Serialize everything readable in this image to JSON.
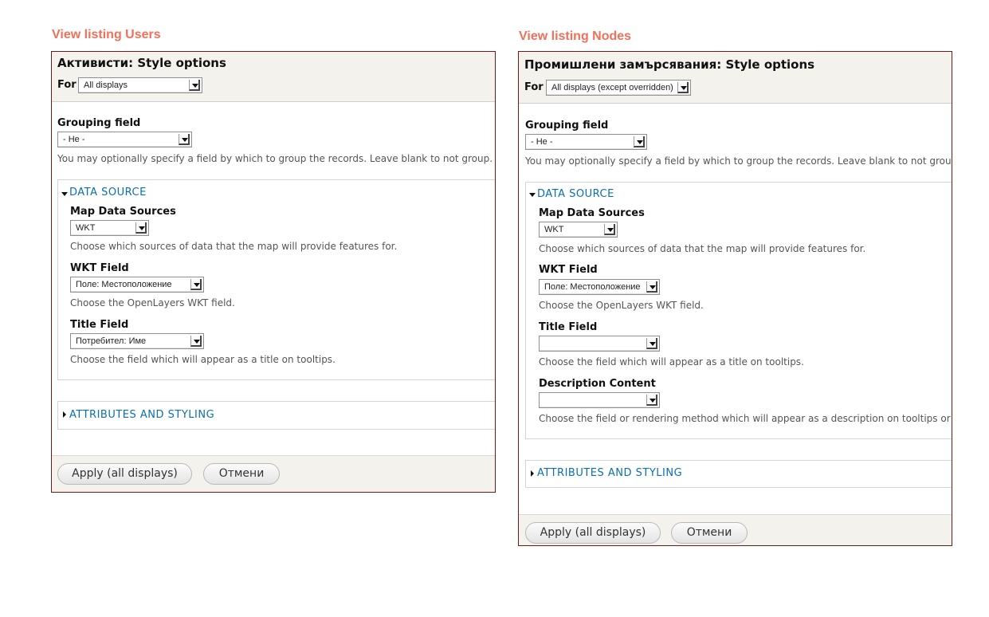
{
  "captions": {
    "left": "View listing Users",
    "right": "View listing Nodes"
  },
  "left_panel": {
    "title": "Активисти: Style options",
    "for_label": "For",
    "for_value": "All displays",
    "grouping_label": "Grouping field",
    "grouping_value": "- Не -",
    "grouping_desc": "You may optionally specify a field by which to group the records. Leave blank to not group.",
    "data_source_legend": "DATA SOURCE",
    "map_sources_label": "Map Data Sources",
    "map_sources_value": "WKT",
    "map_sources_desc": "Choose which sources of data that the map will provide features for.",
    "wkt_label": "WKT Field",
    "wkt_value": "Поле: Местоположение",
    "wkt_desc": "Choose the OpenLayers WKT field.",
    "title_field_label": "Title Field",
    "title_field_value": "Потребител: Име",
    "title_field_desc": "Choose the field which will appear as a title on tooltips.",
    "attributes_legend": "ATTRIBUTES AND STYLING",
    "apply_button": "Apply (all displays)",
    "cancel_button": "Отмени"
  },
  "right_panel": {
    "title": "Промишлени замърсявания: Style options",
    "for_label": "For",
    "for_value": "All displays (except overridden)",
    "grouping_label": "Grouping field",
    "grouping_value": "- Не -",
    "grouping_desc": "You may optionally specify a field by which to group the records. Leave blank to not group.",
    "data_source_legend": "DATA SOURCE",
    "map_sources_label": "Map Data Sources",
    "map_sources_value": "WKT",
    "map_sources_desc": "Choose which sources of data that the map will provide features for.",
    "wkt_label": "WKT Field",
    "wkt_value": "Поле: Местоположение",
    "wkt_desc": "Choose the OpenLayers WKT field.",
    "title_field_label": "Title Field",
    "title_field_value": "",
    "title_field_desc": "Choose the field which will appear as a title on tooltips.",
    "description_label": "Description Content",
    "description_value": "",
    "description_desc": "Choose the field or rendering method which will appear as a description on tooltips or po",
    "attributes_legend": "ATTRIBUTES AND STYLING",
    "apply_button": "Apply (all displays)",
    "cancel_button": "Отмени"
  },
  "icons": {
    "select_arrow": "chevron-down-icon",
    "expanded": "triangle-down-icon",
    "collapsed": "triangle-right-icon"
  },
  "colors": {
    "caption": "#f0705a",
    "legend_link": "#0a6fb0",
    "panel_border": "#6b1a1a",
    "panel_header_bg": "#f3f2ec"
  }
}
